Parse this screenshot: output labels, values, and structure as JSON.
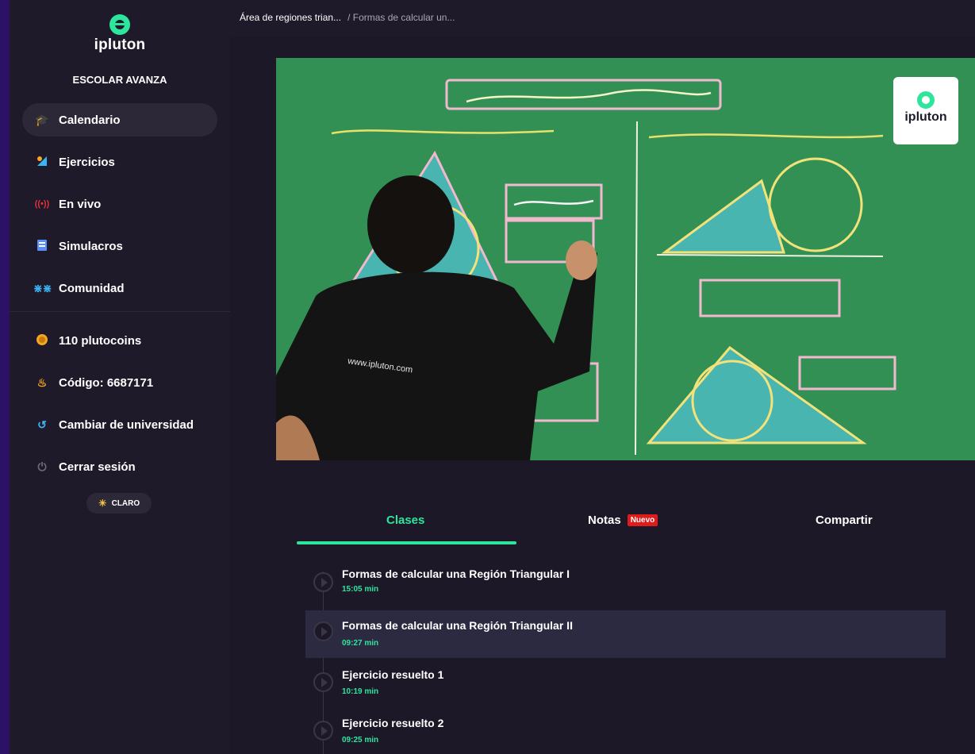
{
  "brand": {
    "name": "ipluton",
    "school": "ESCOLAR AVANZA"
  },
  "sidebar": {
    "nav": [
      {
        "label": "Calendario",
        "icon": "graduation-cap-icon",
        "active": true
      },
      {
        "label": "Ejercicios",
        "icon": "pencil-ruler-icon",
        "active": false
      },
      {
        "label": "En vivo",
        "icon": "broadcast-icon",
        "active": false
      },
      {
        "label": "Simulacros",
        "icon": "clipboard-icon",
        "active": false
      },
      {
        "label": "Comunidad",
        "icon": "people-icon",
        "active": false
      }
    ],
    "account": [
      {
        "label": "110 plutocoins",
        "icon": "coin-icon"
      },
      {
        "label": "Código: 6687171",
        "icon": "bell-icon"
      },
      {
        "label": "Cambiar de universidad",
        "icon": "swap-icon"
      },
      {
        "label": "Cerrar sesión",
        "icon": "power-icon"
      }
    ],
    "theme_label": "CLARO"
  },
  "breadcrumb": {
    "item1": "Área de regiones trian...",
    "item2": "/ Formas de calcular un..."
  },
  "video": {
    "logo_text": "ipluton"
  },
  "tabs": {
    "clases": "Clases",
    "notas": "Notas",
    "notas_badge": "Nuevo",
    "compartir": "Compartir"
  },
  "lessons": [
    {
      "title": "Formas de calcular una Región Triangular I",
      "duration": "15:05 min"
    },
    {
      "title": "Formas de calcular una Región Triangular II",
      "duration": "09:27 min"
    },
    {
      "title": "Ejercicio resuelto 1",
      "duration": "10:19 min"
    },
    {
      "title": "Ejercicio resuelto 2",
      "duration": "09:25 min"
    }
  ],
  "colors": {
    "accent": "#2ee59d",
    "background": "#1c1827",
    "sidebar": "#1e1a29",
    "badge": "#e01b1b"
  }
}
